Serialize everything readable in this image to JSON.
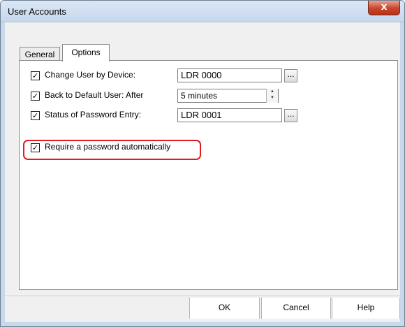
{
  "window": {
    "title": "User Accounts",
    "close_label": "x"
  },
  "tabs": [
    {
      "label": "General",
      "selected": false
    },
    {
      "label": "Options",
      "selected": true
    }
  ],
  "options": {
    "change_user": {
      "checked": true,
      "check_mark": "✓",
      "label": "Change User by Device:",
      "value": "LDR 0000",
      "browse_label": "..."
    },
    "back_to_default": {
      "checked": true,
      "check_mark": "✓",
      "label": "Back to Default User:  After",
      "value": "5 minutes"
    },
    "password_status": {
      "checked": true,
      "check_mark": "✓",
      "label": "Status of Password Entry:",
      "value": "LDR 0001",
      "browse_label": "..."
    },
    "require_password": {
      "checked": true,
      "check_mark": "✓",
      "label": "Require a password automatically"
    }
  },
  "buttons": {
    "ok": "OK",
    "cancel": "Cancel",
    "help": "Help"
  },
  "colors": {
    "highlight": "#e11b22",
    "close_button": "#c9442a"
  }
}
